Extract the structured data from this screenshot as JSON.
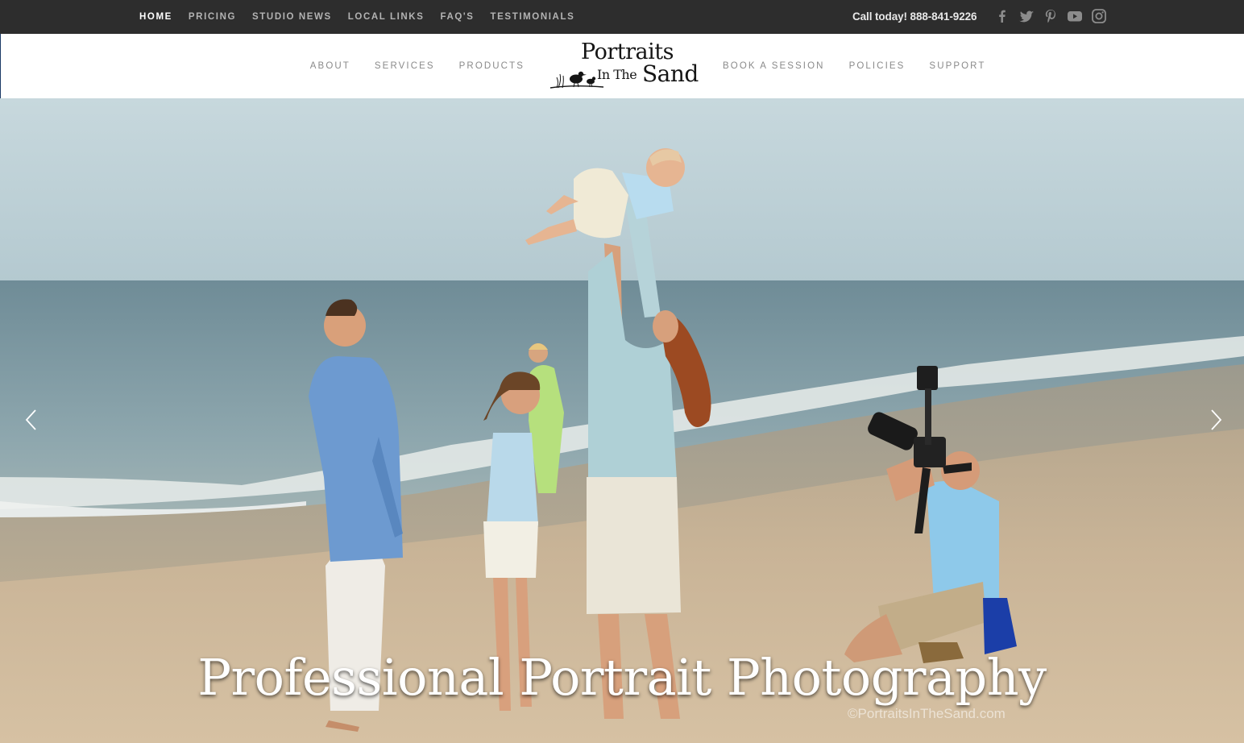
{
  "topbar": {
    "nav": [
      {
        "label": "HOME",
        "active": true
      },
      {
        "label": "PRICING",
        "active": false
      },
      {
        "label": "STUDIO NEWS",
        "active": false
      },
      {
        "label": "LOCAL LINKS",
        "active": false
      },
      {
        "label": "FAQ'S",
        "active": false
      },
      {
        "label": "TESTIMONIALS",
        "active": false
      }
    ],
    "call_text": "Call today! 888-841-9226",
    "social": [
      "facebook-icon",
      "twitter-icon",
      "pinterest-icon",
      "youtube-icon",
      "instagram-icon"
    ]
  },
  "header": {
    "nav_left": [
      "ABOUT",
      "SERVICES",
      "PRODUCTS"
    ],
    "nav_right": [
      "BOOK A SESSION",
      "POLICIES",
      "SUPPORT"
    ],
    "logo": {
      "line1": "Portraits",
      "line2": "In The",
      "line3": "Sand"
    }
  },
  "hero": {
    "headline": "Professional Portrait Photography",
    "watermark": "©PortraitsInTheSand.com",
    "prev_icon": "chevron-left-icon",
    "next_icon": "chevron-right-icon"
  },
  "colors": {
    "topbar_bg": "#2d2d2d",
    "nav_active": "#ffffff",
    "nav_inactive": "#b3b3b3",
    "main_nav": "#8a8a8a"
  }
}
